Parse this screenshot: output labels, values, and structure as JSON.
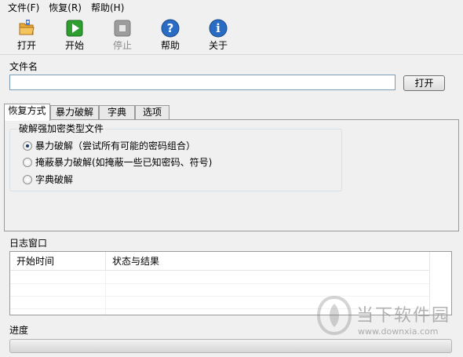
{
  "menu": [
    {
      "label": "文件(F)"
    },
    {
      "label": "恢复(R)"
    },
    {
      "label": "帮助(H)"
    }
  ],
  "toolbar": {
    "open_label": "打开",
    "start_label": "开始",
    "stop_label": "停止",
    "help_label": "帮助",
    "about_label": "关于"
  },
  "file": {
    "section_label": "文件名",
    "value": "",
    "open_button": "打开"
  },
  "tabs": [
    {
      "label": "恢复方式",
      "active": true
    },
    {
      "label": "暴力破解",
      "active": false
    },
    {
      "label": "字典",
      "active": false
    },
    {
      "label": "选项",
      "active": false
    }
  ],
  "recovery": {
    "group_label": "破解强加密类型文件",
    "options": [
      {
        "label": "暴力破解（尝试所有可能的密码组合）",
        "checked": true
      },
      {
        "label": "掩蔽暴力破解(如掩蔽一些已知密码、符号)",
        "checked": false
      },
      {
        "label": "字典破解",
        "checked": false
      }
    ]
  },
  "log": {
    "section_label": "日志窗口",
    "columns": [
      "开始时间",
      "状态与结果"
    ],
    "rows": []
  },
  "progress": {
    "label": "进度",
    "value": 0
  },
  "watermark": {
    "brand": "当下软件园",
    "url": "www.downxia.com"
  },
  "colors": {
    "help_icon": "#2a6cc4",
    "start_icon": "#2e9e2e",
    "folder_icon": "#e8a93a"
  }
}
